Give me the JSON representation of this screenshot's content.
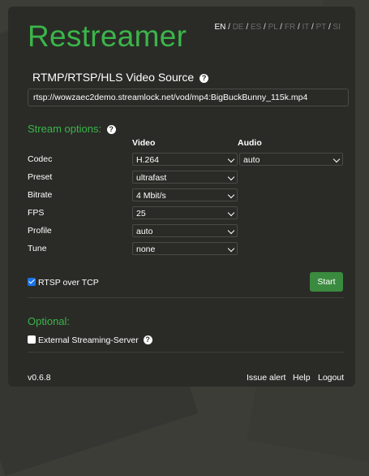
{
  "app": {
    "title": "Restreamer"
  },
  "languages": [
    {
      "code": "EN",
      "active": true
    },
    {
      "code": "DE",
      "active": false
    },
    {
      "code": "ES",
      "active": false
    },
    {
      "code": "PL",
      "active": false
    },
    {
      "code": "FR",
      "active": false
    },
    {
      "code": "IT",
      "active": false
    },
    {
      "code": "PT",
      "active": false
    },
    {
      "code": "SI",
      "active": false
    }
  ],
  "source": {
    "label": "RTMP/RTSP/HLS Video Source",
    "url": "rtsp://wowzaec2demo.streamlock.net/vod/mp4:BigBuckBunny_115k.mp4"
  },
  "stream_options": {
    "label": "Stream options:",
    "video_header": "Video",
    "audio_header": "Audio",
    "rows": [
      {
        "label": "Codec",
        "video": "H.264",
        "audio": "auto"
      },
      {
        "label": "Preset",
        "video": "ultrafast"
      },
      {
        "label": "Bitrate",
        "video": "4 Mbit/s"
      },
      {
        "label": "FPS",
        "video": "25"
      },
      {
        "label": "Profile",
        "video": "auto"
      },
      {
        "label": "Tune",
        "video": "none"
      }
    ],
    "rtsp_tcp_label": "RTSP over TCP",
    "rtsp_tcp_checked": true,
    "start_label": "Start"
  },
  "optional": {
    "label": "Optional:",
    "external_label": "External Streaming-Server",
    "external_checked": false
  },
  "footer": {
    "version": "v0.6.8",
    "issue_alert": "Issue alert",
    "help": "Help",
    "logout": "Logout"
  },
  "colors": {
    "accent_green": "#3bb54a",
    "button_green": "#3a8b3f",
    "panel": "#2a2b27"
  }
}
